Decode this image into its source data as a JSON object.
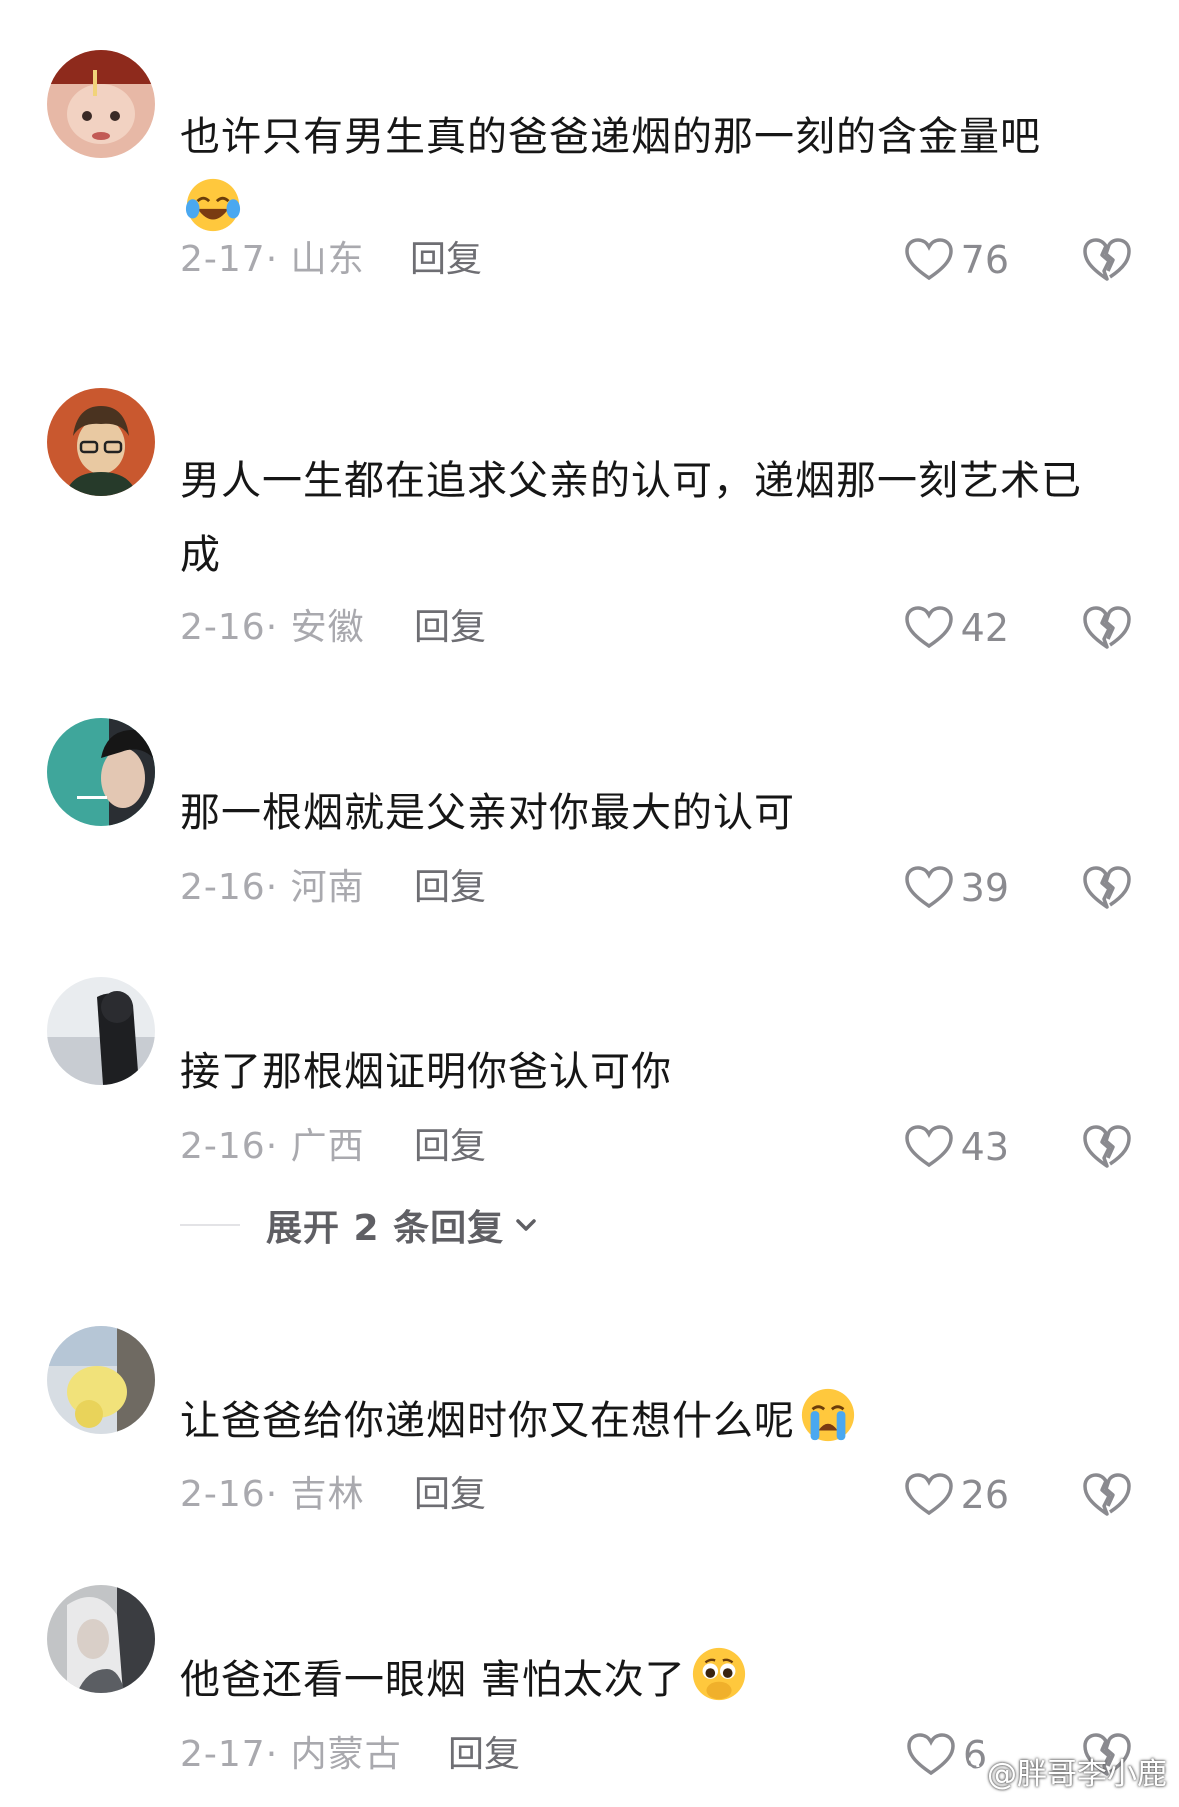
{
  "comments": [
    {
      "text": "也许只有男生真的爸爸递烟的那一刻的含金量吧",
      "emoji": "face-with-tears-of-joy",
      "date": "2-17",
      "location": "山东",
      "reply": "回复",
      "likes": "76"
    },
    {
      "text": "男人一生都在追求父亲的认可，递烟那一刻艺术已成",
      "emoji": "",
      "date": "2-16",
      "location": "安徽",
      "reply": "回复",
      "likes": "42"
    },
    {
      "text": "那一根烟就是父亲对你最大的认可",
      "emoji": "",
      "date": "2-16",
      "location": "河南",
      "reply": "回复",
      "likes": "39"
    },
    {
      "text": "接了那根烟证明你爸认可你",
      "emoji": "",
      "date": "2-16",
      "location": "广西",
      "reply": "回复",
      "likes": "43"
    },
    {
      "text": "让爸爸给你递烟时你又在想什么呢",
      "emoji": "loudly-crying-face",
      "date": "2-16",
      "location": "吉林",
      "reply": "回复",
      "likes": "26"
    },
    {
      "text": "他爸还看一眼烟 害怕太次了",
      "emoji": "face-holding-back-tears",
      "date": "2-17",
      "location": "内蒙古",
      "reply": "回复",
      "likes": "6"
    }
  ],
  "expand_replies": "展开 2 条回复",
  "watermark": "@胖哥李小鹿",
  "colors": {
    "text": "#161616",
    "meta": "#a9a9ae",
    "reply": "#6e6e73",
    "icon": "#8a8a8f"
  }
}
